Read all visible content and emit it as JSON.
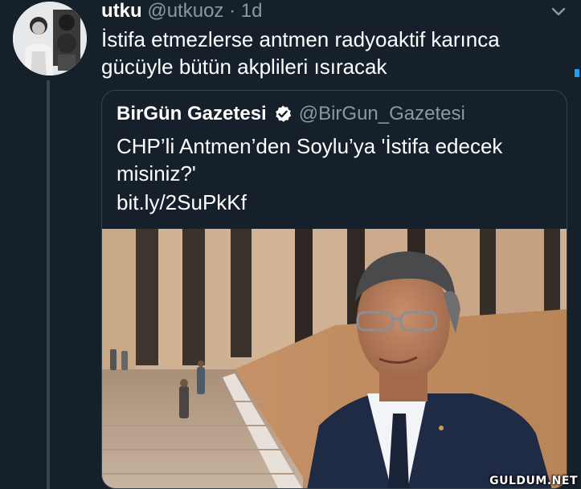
{
  "tweet": {
    "display_name": "utku",
    "handle": "@utkuoz",
    "separator": "·",
    "time": "1d",
    "text": "İstifa etmezlerse antmen radyoaktif karınca gücüyle bütün akplileri ısıracak"
  },
  "quoted_tweet": {
    "display_name": "BirGün Gazetesi",
    "handle": "@BirGun_Gazetesi",
    "text": "CHP’li Antmen’den Soylu’ya 'İstifa edecek misiniz?'",
    "link": "bit.ly/2SuPkKf"
  },
  "watermark": "GULDUM.NET",
  "icons": {
    "menu": "chevron-down-icon",
    "verified": "verified-badge-icon"
  },
  "colors": {
    "background": "#15202b",
    "secondary_text": "#8899a6",
    "border": "#38444d",
    "accent": "#1da1f2"
  }
}
